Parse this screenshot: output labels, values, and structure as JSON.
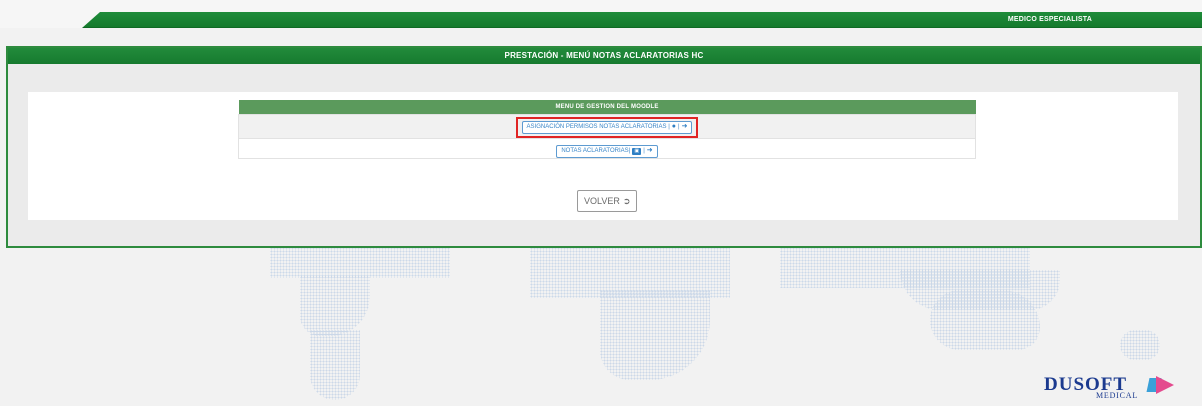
{
  "header": {
    "user_role": "MEDICO ESPECIALISTA"
  },
  "panel": {
    "title": "PRESTACIÓN - MENÚ NOTAS ACLARATORIAS HC"
  },
  "menu": {
    "heading": "MENU DE GESTION DEL MOODLE",
    "items": [
      {
        "label": "ASIGNACIÓN PERMISOS NOTAS ACLARATORIAS |",
        "icons": [
          "users-icon",
          "sign-in-icon"
        ]
      },
      {
        "label": "NOTAS ACLARATORIAS|",
        "icons": [
          "id-card-icon",
          "sign-in-icon"
        ]
      }
    ]
  },
  "actions": {
    "back_label": "VOLVER"
  },
  "logo": {
    "name": "DUSOFT",
    "sub": "MEDICAL"
  },
  "colors": {
    "brand_green": "#1f8c3a",
    "highlight_red": "#e02424",
    "link_blue": "#3a86c8",
    "logo_blue": "#1b3a8f",
    "logo_pink": "#e44a8e"
  }
}
